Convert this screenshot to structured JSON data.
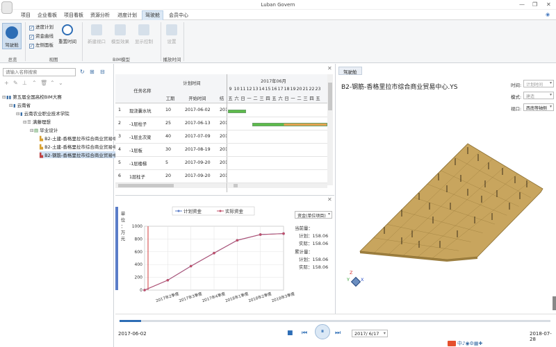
{
  "app": {
    "title": "Luban Govern"
  },
  "window": {
    "minimize": "—",
    "restore": "❐",
    "close": "✕"
  },
  "menu": [
    {
      "label": "项目"
    },
    {
      "label": "企业看板"
    },
    {
      "label": "项目看板"
    },
    {
      "label": "资源分析"
    },
    {
      "label": "进度计划"
    },
    {
      "label": "驾驶舱"
    },
    {
      "label": "会员中心"
    }
  ],
  "ribbon": {
    "cockpit_label": "驾驶舱",
    "checks": [
      "进度计划",
      "资金曲线",
      "左侧面板"
    ],
    "reset_time_label": "重置时间",
    "bim_buttons": [
      "新建视口",
      "模型效果",
      "显示控制"
    ],
    "settings_label": "设置",
    "groups": [
      "总览",
      "视图",
      "BIM模型",
      "播放时间"
    ]
  },
  "left_panel": {
    "search_placeholder": "请输入名称搜索",
    "tree": [
      {
        "label": "第五届全国高校BIM大赛"
      },
      {
        "label": "云南省"
      },
      {
        "label": "云南农业职业技术学院"
      },
      {
        "label": "满藤理想"
      },
      {
        "label": "毕业设计"
      },
      {
        "label": "B2-土建-香格里拉市综合商业贸易中"
      },
      {
        "label": "B2-土建-香格里拉市综合商业贸易中"
      },
      {
        "label": "B2-钢筋-香格里拉市综合商业贸易中"
      }
    ]
  },
  "gantt": {
    "headers": {
      "task_name": "任务名称",
      "plan_time": "计划时间",
      "duration": "工期",
      "start_time": "开始时间",
      "finish_short": "结",
      "month": "2017年06月"
    },
    "days": [
      "9",
      "10",
      "11",
      "12",
      "13",
      "14",
      "15",
      "16",
      "17",
      "18",
      "19",
      "20",
      "21",
      "22",
      "23"
    ],
    "weekdays": [
      "五",
      "六",
      "日",
      "一",
      "二",
      "三",
      "四",
      "五",
      "六",
      "日",
      "一",
      "二",
      "三",
      "四",
      "五"
    ],
    "rows": [
      {
        "num": "1",
        "name": "现浇囊水坑",
        "dur": "10",
        "start": "2017-06-02",
        "end": "201"
      },
      {
        "num": "2",
        "name": "-1层柱子",
        "dur": "25",
        "start": "2017-06-13",
        "end": "201"
      },
      {
        "num": "3",
        "name": "-1层主次梁",
        "dur": "40",
        "start": "2017-07-09",
        "end": "201"
      },
      {
        "num": "4",
        "name": "-1层板",
        "dur": "30",
        "start": "2017-08-19",
        "end": "201"
      },
      {
        "num": "5",
        "name": "-1层楼梯",
        "dur": "5",
        "start": "2017-09-20",
        "end": "201"
      },
      {
        "num": "6",
        "name": "1层柱子",
        "dur": "20",
        "start": "2017-09-20",
        "end": "201"
      }
    ]
  },
  "chart_data": {
    "type": "line",
    "ylabel_chars": [
      "单",
      "位",
      "：",
      "万",
      "元"
    ],
    "ylim": [
      0,
      1000
    ],
    "yticks": [
      "0",
      "200",
      "400",
      "600",
      "800",
      "1000"
    ],
    "categories": [
      "2017年1季度",
      "2017年2季度",
      "2017年3季度",
      "2017年4季度",
      "2018年1季度",
      "2018年2季度",
      "2018年3季度"
    ],
    "series": [
      {
        "name": "计划资金",
        "color": "#5a7dc8",
        "values": [
          0,
          155,
          375,
          580,
          780,
          870,
          885
        ]
      },
      {
        "name": "实际资金",
        "color": "#c0506a",
        "values": [
          0,
          155,
          375,
          580,
          780,
          870,
          885
        ]
      }
    ],
    "marker_x": "2017年2季度"
  },
  "fund_info": {
    "select": "资金(单位项目)",
    "current_label": "当前量：",
    "plan1": "计划：158.06",
    "actual1": "实际：158.06",
    "cum_label": "累计量：",
    "plan2": "计划：158.06",
    "actual2": "实际：158.06"
  },
  "bim": {
    "tab": "驾驶舱",
    "title": "B2-钢筋-香格里拉市综合商业贸易中心.YS",
    "time_label": "时间:",
    "time_value": "计划时间",
    "mode_label": "模式:",
    "mode_value": "建造",
    "view_label": "视口:",
    "view_value": "西南等轴侧",
    "axes": {
      "z": "Z",
      "y": "Y",
      "x": "X"
    },
    "slab_color": "#c8a55e"
  },
  "playback": {
    "start": "2017-06-02",
    "end": "2018-07-28",
    "current": "2017/ 6/17",
    "progress": 0.05
  }
}
